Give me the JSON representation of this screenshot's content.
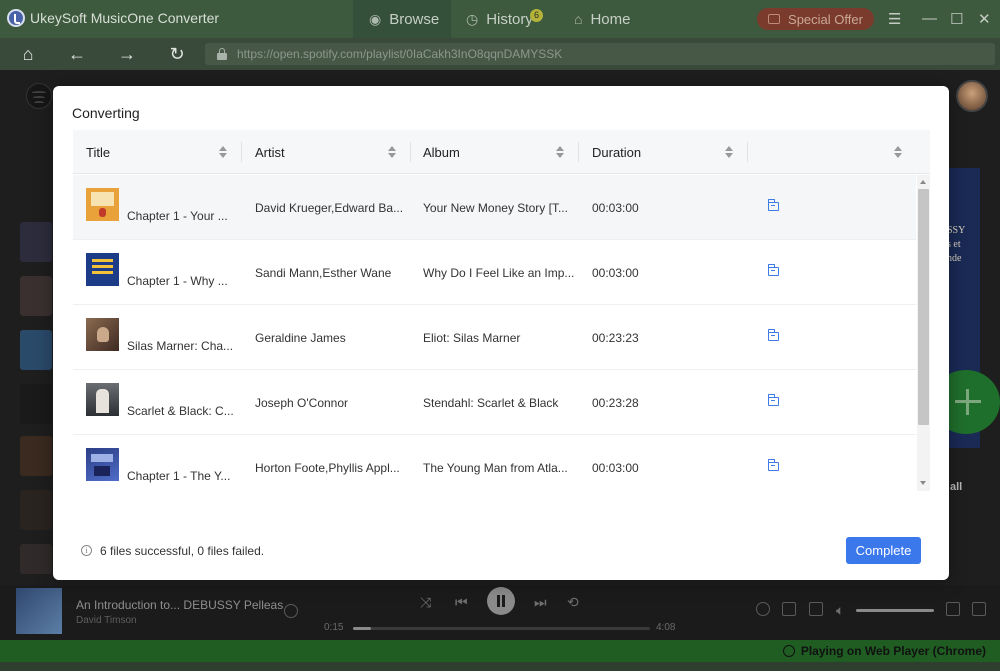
{
  "app": {
    "title": "UkeySoft MusicOne Converter",
    "tabs": [
      {
        "label": "Browse",
        "icon": "globe-icon"
      },
      {
        "label": "History",
        "icon": "clock-icon",
        "badge": "6"
      },
      {
        "label": "Home",
        "icon": "home-icon"
      }
    ],
    "special_offer": "Special Offer"
  },
  "address_bar": {
    "url": "https://open.spotify.com/playlist/0IaCakh3InO8qqnDAMYSSK"
  },
  "modal": {
    "title": "Converting",
    "columns": [
      "Title",
      "Artist",
      "Album",
      "Duration",
      ""
    ],
    "rows": [
      {
        "title": "Chapter 1 - Your ...",
        "artist": "David Krueger,Edward Ba...",
        "album": "Your New Money Story [T...",
        "duration": "00:03:00"
      },
      {
        "title": "Chapter 1 - Why ...",
        "artist": "Sandi Mann,Esther Wane",
        "album": "Why Do I Feel Like an Imp...",
        "duration": "00:03:00"
      },
      {
        "title": "Silas Marner: Cha...",
        "artist": "Geraldine James",
        "album": "Eliot: Silas Marner",
        "duration": "00:23:23"
      },
      {
        "title": "Scarlet & Black: C...",
        "artist": "Joseph O'Connor",
        "album": "Stendahl: Scarlet & Black",
        "duration": "00:23:28"
      },
      {
        "title": "Chapter 1 - The Y...",
        "artist": "Horton Foote,Phyllis Appl...",
        "album": "The Young Man from Atla...",
        "duration": "00:03:00"
      }
    ],
    "summary": "6 files successful, 0 files failed.",
    "complete_label": "Complete"
  },
  "player": {
    "track": "An Introduction to... DEBUSSY Pelleas",
    "artist": "David Timson",
    "current_time": "0:15",
    "total_time": "4:08",
    "progress_fraction": 0.06
  },
  "background": {
    "see_all": "all"
  },
  "status": {
    "text": "Playing on Web Player (Chrome)"
  },
  "colors": {
    "accent": "#3b78ec",
    "titlebar": "#3e5a3e",
    "status_bar": "#1f5d22"
  }
}
